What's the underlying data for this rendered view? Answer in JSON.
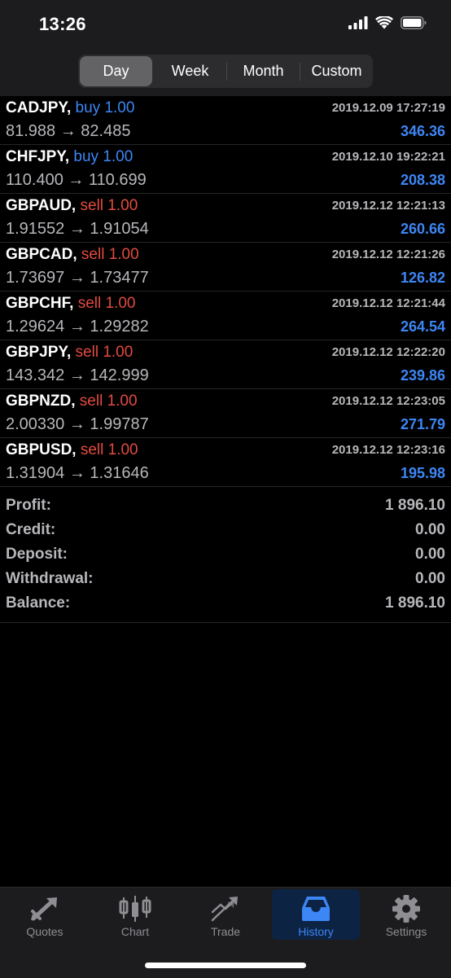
{
  "status_bar": {
    "time": "13:26"
  },
  "period_tabs": [
    {
      "label": "Day",
      "active": true
    },
    {
      "label": "Week",
      "active": false
    },
    {
      "label": "Month",
      "active": false
    },
    {
      "label": "Custom",
      "active": false
    }
  ],
  "deals": [
    {
      "symbol": "CADJPY,",
      "side": "buy 1.00",
      "type": "buy",
      "time": "2019.12.09 17:27:19",
      "prices": "81.988 → 82.485",
      "profit": "346.36"
    },
    {
      "symbol": "CHFJPY,",
      "side": "buy 1.00",
      "type": "buy",
      "time": "2019.12.10 19:22:21",
      "prices": "110.400 → 110.699",
      "profit": "208.38"
    },
    {
      "symbol": "GBPAUD,",
      "side": "sell 1.00",
      "type": "sell",
      "time": "2019.12.12 12:21:13",
      "prices": "1.91552 → 1.91054",
      "profit": "260.66"
    },
    {
      "symbol": "GBPCAD,",
      "side": "sell 1.00",
      "type": "sell",
      "time": "2019.12.12 12:21:26",
      "prices": "1.73697 → 1.73477",
      "profit": "126.82"
    },
    {
      "symbol": "GBPCHF,",
      "side": "sell 1.00",
      "type": "sell",
      "time": "2019.12.12 12:21:44",
      "prices": "1.29624 → 1.29282",
      "profit": "264.54"
    },
    {
      "symbol": "GBPJPY,",
      "side": "sell 1.00",
      "type": "sell",
      "time": "2019.12.12 12:22:20",
      "prices": "143.342 → 142.999",
      "profit": "239.86"
    },
    {
      "symbol": "GBPNZD,",
      "side": "sell 1.00",
      "type": "sell",
      "time": "2019.12.12 12:23:05",
      "prices": "2.00330 → 1.99787",
      "profit": "271.79"
    },
    {
      "symbol": "GBPUSD,",
      "side": "sell 1.00",
      "type": "sell",
      "time": "2019.12.12 12:23:16",
      "prices": "1.31904 → 1.31646",
      "profit": "195.98"
    }
  ],
  "summary": [
    {
      "label": "Profit:",
      "value": "1 896.10"
    },
    {
      "label": "Credit:",
      "value": "0.00"
    },
    {
      "label": "Deposit:",
      "value": "0.00"
    },
    {
      "label": "Withdrawal:",
      "value": "0.00"
    },
    {
      "label": "Balance:",
      "value": "1 896.10"
    }
  ],
  "tabs": [
    {
      "label": "Quotes",
      "icon": "quotes-icon",
      "active": false
    },
    {
      "label": "Chart",
      "icon": "chart-candles-icon",
      "active": false
    },
    {
      "label": "Trade",
      "icon": "trade-icon",
      "active": false
    },
    {
      "label": "History",
      "icon": "history-inbox-icon",
      "active": true
    },
    {
      "label": "Settings",
      "icon": "gear-icon",
      "active": false
    }
  ],
  "colors": {
    "buy": "#3d86f5",
    "sell": "#e24b40",
    "profit": "#3d86f5",
    "active_tab": "#3d86f5",
    "background": "#000000"
  }
}
